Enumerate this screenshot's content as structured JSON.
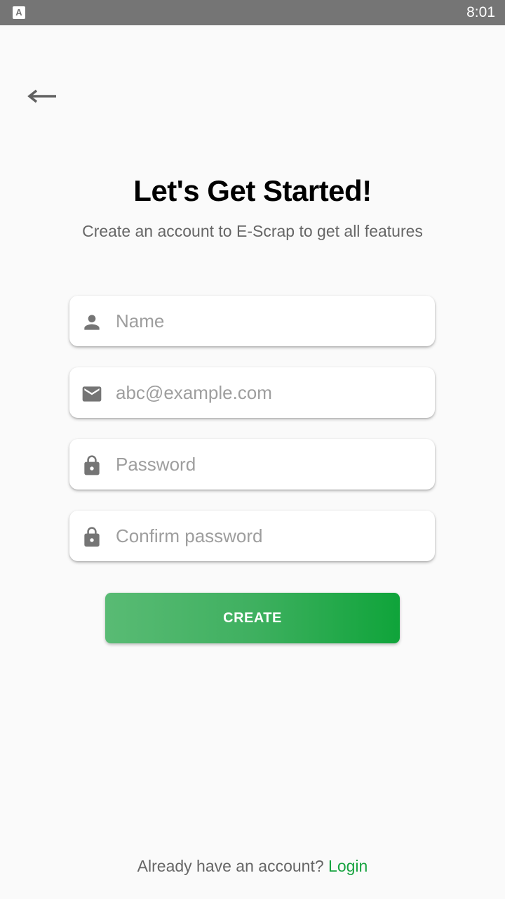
{
  "status_bar": {
    "app_icon_letter": "A",
    "time": "8:01"
  },
  "header": {
    "back_icon": "arrow-left-icon"
  },
  "title": "Let's Get Started!",
  "subtitle": "Create an account to E-Scrap to get all features",
  "form": {
    "name": {
      "icon": "person-icon",
      "placeholder": "Name",
      "value": ""
    },
    "email": {
      "icon": "mail-icon",
      "placeholder": "abc@example.com",
      "value": ""
    },
    "password": {
      "icon": "lock-icon",
      "placeholder": "Password",
      "value": ""
    },
    "confirm_password": {
      "icon": "lock-icon",
      "placeholder": "Confirm password",
      "value": ""
    },
    "submit_label": "CREATE"
  },
  "footer": {
    "prompt": "Already have an account? ",
    "link_label": "Login"
  },
  "colors": {
    "accent": "#17a340",
    "button_gradient_start": "#59bb74",
    "button_gradient_end": "#0fa43a",
    "status_bar": "#757575",
    "icon": "#757575",
    "background": "#fafafa"
  }
}
